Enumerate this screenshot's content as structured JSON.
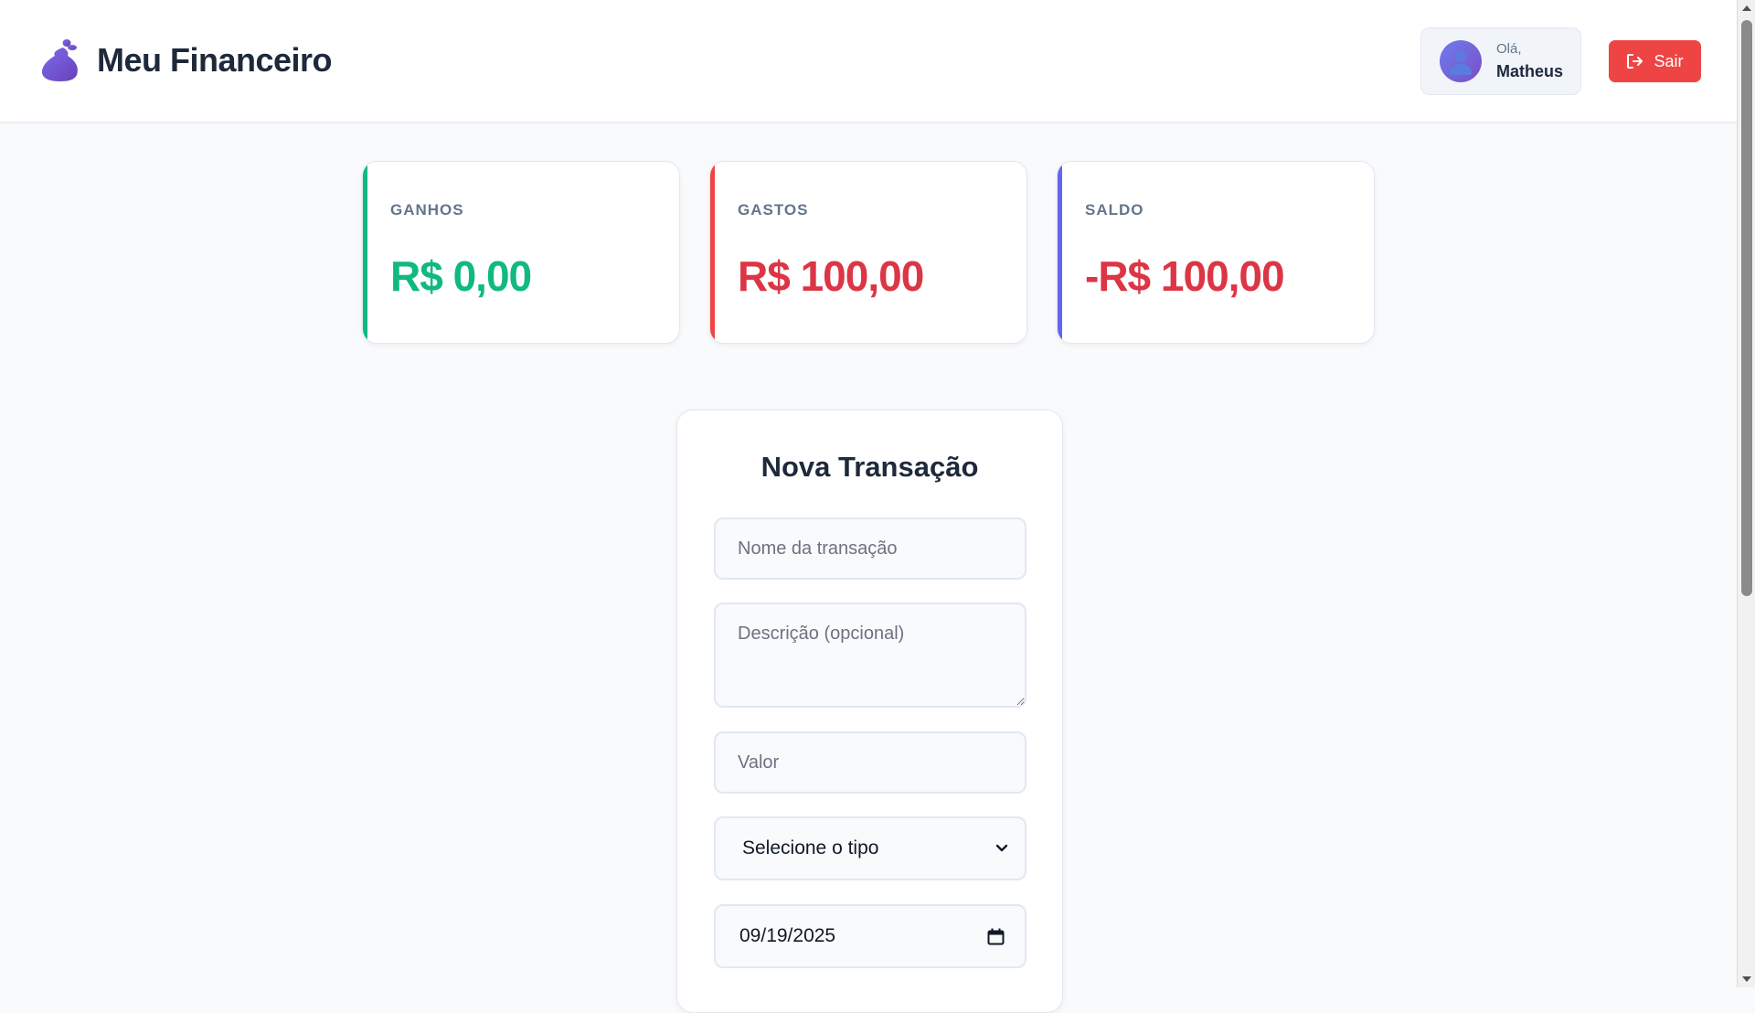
{
  "header": {
    "app_title": "Meu Financeiro",
    "brand_icon": "money-bag-icon",
    "user": {
      "greeting": "Olá,",
      "name": "Matheus",
      "avatar_icon": "user-icon"
    },
    "logout_label": "Sair",
    "logout_icon": "logout-icon"
  },
  "summary": {
    "income": {
      "label": "GANHOS",
      "value": "R$ 0,00",
      "color": "#10b981"
    },
    "expense": {
      "label": "GASTOS",
      "value": "R$ 100,00",
      "color": "#ef4444"
    },
    "balance": {
      "label": "SALDO",
      "value": "-R$ 100,00",
      "color": "#6366f1"
    }
  },
  "form": {
    "title": "Nova Transação",
    "name_placeholder": "Nome da transação",
    "description_placeholder": "Descrição (opcional)",
    "amount_placeholder": "Valor",
    "type_selected": "Selecione o tipo",
    "date_value": "09/19/2025"
  },
  "colors": {
    "accent": "#6366f1",
    "income": "#10b981",
    "expense": "#ef4444",
    "negative_text": "#dc3545",
    "logout_button": "#ef4444"
  }
}
